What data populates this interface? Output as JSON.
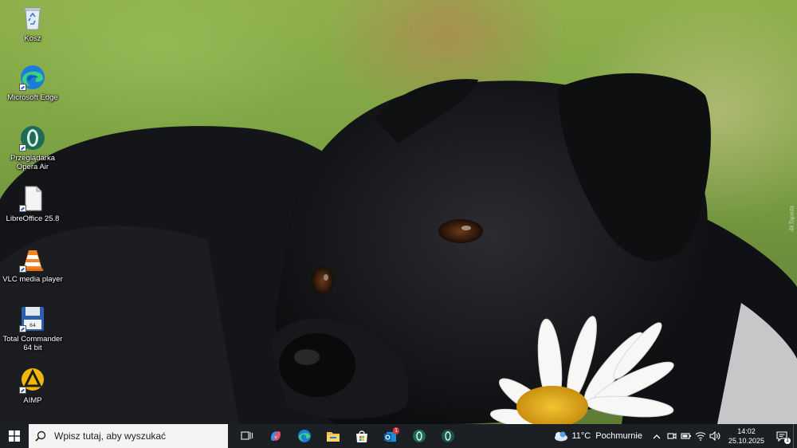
{
  "desktop": {
    "icons": [
      {
        "label": "Kosz",
        "icon": "recycle-bin-icon"
      },
      {
        "label": "Microsoft Edge",
        "icon": "edge-icon"
      },
      {
        "label": "Przeglądarka Opera Air",
        "icon": "opera-air-icon"
      },
      {
        "label": "LibreOffice 25.8",
        "icon": "libreoffice-icon"
      },
      {
        "label": "VLC media player",
        "icon": "vlc-icon"
      },
      {
        "label": "Total Commander 64 bit",
        "icon": "total-commander-icon"
      },
      {
        "label": "AIMP",
        "icon": "aimp-icon"
      }
    ],
    "watermark": "4kTapeta"
  },
  "taskbar": {
    "search_placeholder": "Wpisz tutaj, aby wyszukać",
    "pinned": [
      "task-view-icon",
      "copilot-icon",
      "edge-icon",
      "file-explorer-icon",
      "microsoft-store-icon",
      "outlook-icon",
      "opera-air-icon",
      "opera-air-icon"
    ],
    "weather": {
      "temp": "11°C",
      "condition": "Pochmurnie"
    },
    "clock": {
      "time": "14:02",
      "date": "25.10.2025"
    },
    "notification_count": "1",
    "outlook_badge": "1"
  },
  "colors": {
    "taskbar": "#1c2025",
    "accent": "#0078d4"
  }
}
